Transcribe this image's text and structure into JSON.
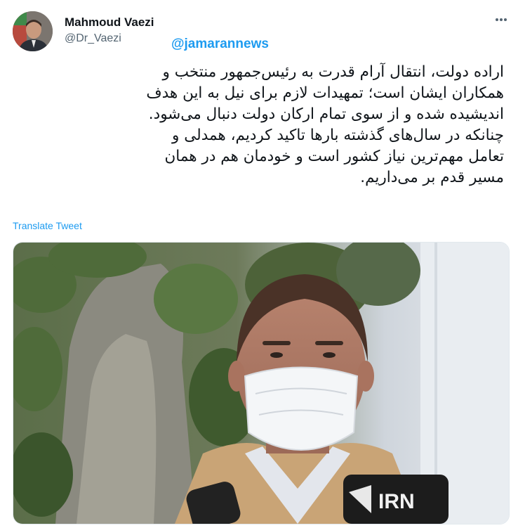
{
  "author": {
    "display_name": "Mahmoud Vaezi",
    "handle": "@Dr_Vaezi",
    "avatar_icon": "profile-photo"
  },
  "watermark": "@jamarannews",
  "more_icon": "ellipsis-icon",
  "tweet": {
    "lines": [
      "اراده دولت، انتقال آرام قدرت به رئیس‌جمهور منتخب و",
      "همکاران ایشان است؛ تمهیدات لازم برای نیل به این هدف",
      "اندیشیده شده و از سوی تمام ارکان دولت دنبال می‌شود.",
      "چنانکه در سال‌های گذشته بارها تاکید کردیم، همدلی و",
      "تعامل مهم‌ترین نیاز کشور است و خودمان هم در همان",
      "مسیر قدم بر می‌داریم."
    ]
  },
  "translate_label": "Translate Tweet",
  "media": {
    "logo_text": "IRN",
    "colors": {
      "mask": "#f4f6f8",
      "jacket": "#c9a476",
      "tree": "#4f6b3a"
    }
  }
}
